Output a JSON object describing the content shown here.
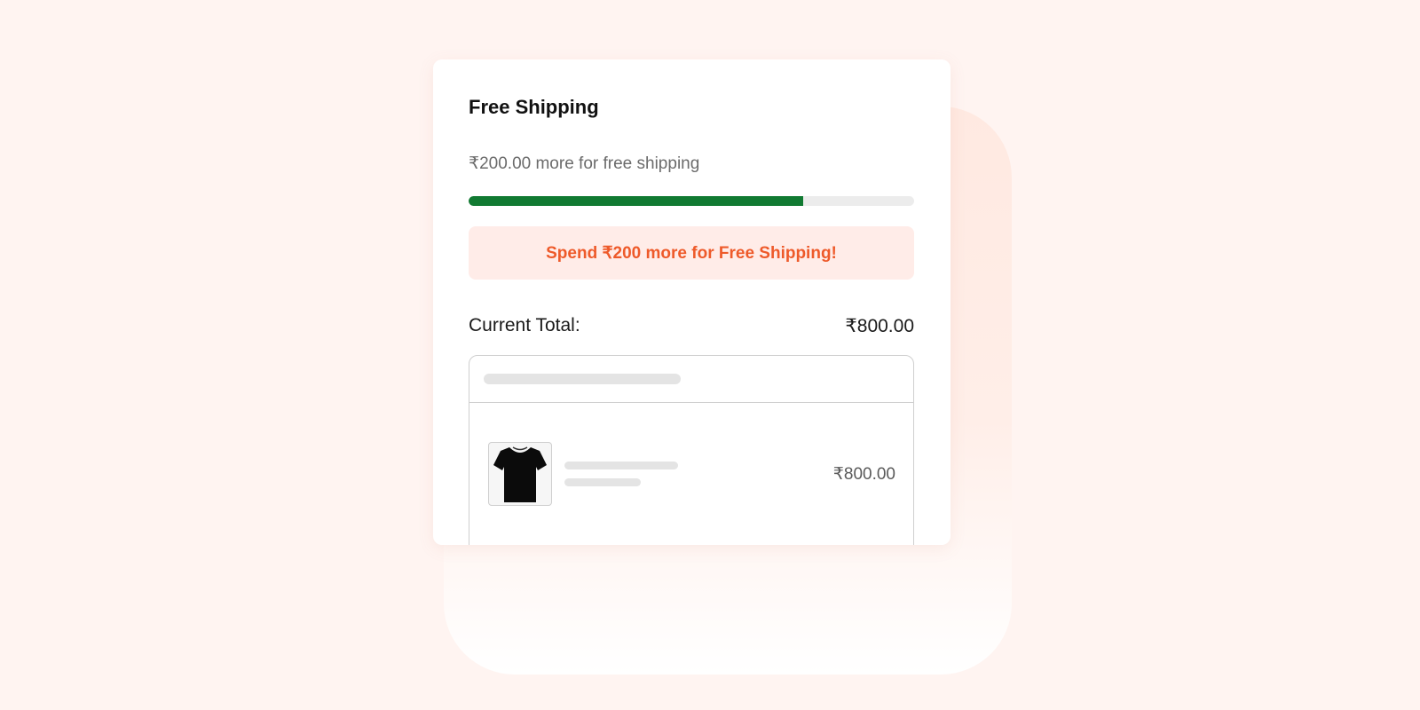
{
  "card": {
    "title": "Free Shipping",
    "remaining_text": "₹200.00 more for free shipping",
    "progress_fraction": 0.75,
    "banner_text": "Spend ₹200 more for Free Shipping!",
    "total_label": "Current Total:",
    "total_value": "₹800.00"
  },
  "order": {
    "items": [
      {
        "image_icon": "tshirt-icon",
        "price": "₹800.00"
      }
    ]
  },
  "colors": {
    "progress_fill": "#117a32",
    "banner_bg": "#ffece8",
    "banner_text": "#ee5a2a",
    "page_bg": "#fff4f1"
  }
}
